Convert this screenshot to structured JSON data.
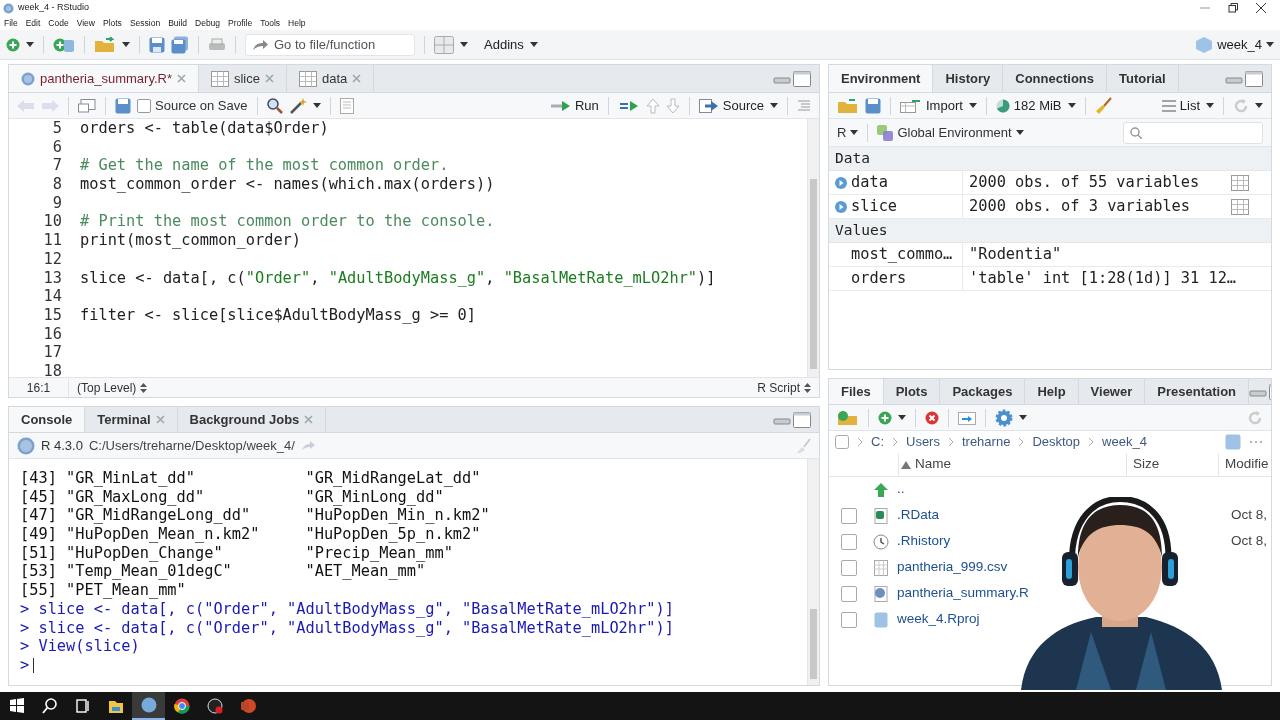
{
  "window": {
    "title": "week_4 - RStudio"
  },
  "menu": [
    "File",
    "Edit",
    "Code",
    "View",
    "Plots",
    "Session",
    "Build",
    "Debug",
    "Profile",
    "Tools",
    "Help"
  ],
  "toolbar": {
    "goto_placeholder": "Go to file/function",
    "addins": "Addins",
    "project": "week_4"
  },
  "editor": {
    "tabs": [
      {
        "label": "pantheria_summary.R*",
        "kind": "script",
        "modified": true,
        "selected": true
      },
      {
        "label": "slice",
        "kind": "data",
        "modified": false,
        "selected": false
      },
      {
        "label": "data",
        "kind": "data",
        "modified": false,
        "selected": false
      }
    ],
    "source_on_save": {
      "label": "Source on Save",
      "checked": false
    },
    "run": "Run",
    "source": "Source",
    "lines": [
      {
        "number": "5",
        "kind": "code",
        "code": "orders <- table(data$Order)"
      },
      {
        "number": "6",
        "kind": "code"
      },
      {
        "number": "7",
        "kind": "comment",
        "code": "# Get the name of the most common order."
      },
      {
        "number": "8",
        "kind": "code",
        "code": "most_common_order <- names(which.max(orders))"
      },
      {
        "number": "9",
        "kind": "code"
      },
      {
        "number": "10",
        "kind": "comment",
        "code": "# Print the most common order to the console."
      },
      {
        "number": "11",
        "kind": "code",
        "code": "print(most_common_order)"
      },
      {
        "number": "12",
        "kind": "code"
      },
      {
        "number": "13",
        "kind": "code",
        "code": "slice <- data[, c(\"Order\", \"AdultBodyMass_g\", \"BasalMetRate_mLO2hr\")]"
      },
      {
        "number": "14",
        "kind": "code"
      },
      {
        "number": "15",
        "kind": "code",
        "code": "filter <- slice[slice$AdultBodyMass_g >= 0]"
      },
      {
        "number": "16",
        "kind": "code"
      },
      {
        "number": "17",
        "kind": "code"
      },
      {
        "number": "18",
        "kind": "code"
      }
    ],
    "status": {
      "position": "16:1",
      "scope": "(Top Level)",
      "file_type": "R Script"
    }
  },
  "console": {
    "tabs": [
      {
        "label": "Console",
        "closable": false,
        "selected": true
      },
      {
        "label": "Terminal",
        "closable": true,
        "selected": false
      },
      {
        "label": "Background Jobs",
        "closable": true,
        "selected": false
      }
    ],
    "version": "R 4.3.0",
    "path": "C:/Users/treharne/Desktop/week_4/",
    "lines": [
      {
        "kind": "output",
        "text": "[43] \"GR_MinLat_dd\"            \"GR_MidRangeLat_dd\""
      },
      {
        "kind": "output",
        "text": "[45] \"GR_MaxLong_dd\"           \"GR_MinLong_dd\""
      },
      {
        "kind": "output",
        "text": "[47] \"GR_MidRangeLong_dd\"      \"HuPopDen_Min_n.km2\""
      },
      {
        "kind": "output",
        "text": "[49] \"HuPopDen_Mean_n.km2\"     \"HuPopDen_5p_n.km2\""
      },
      {
        "kind": "output",
        "text": "[51] \"HuPopDen_Change\"         \"Precip_Mean_mm\""
      },
      {
        "kind": "output",
        "text": "[53] \"Temp_Mean_01degC\"        \"AET_Mean_mm\""
      },
      {
        "kind": "output",
        "text": "[55] \"PET_Mean_mm\""
      },
      {
        "kind": "input",
        "text": "> slice <- data[, c(\"Order\", \"AdultBodyMass_g\", \"BasalMetRate_mLO2hr\")]"
      },
      {
        "kind": "input",
        "text": "> slice <- data[, c(\"Order\", \"AdultBodyMass_g\", \"BasalMetRate_mLO2hr\")]"
      },
      {
        "kind": "input",
        "text": "> View(slice)"
      },
      {
        "kind": "prompt",
        "text": ">"
      }
    ]
  },
  "environment": {
    "tabs": [
      {
        "label": "Environment",
        "selected": true
      },
      {
        "label": "History",
        "selected": false
      },
      {
        "label": "Connections",
        "selected": false
      },
      {
        "label": "Tutorial",
        "selected": false
      }
    ],
    "import": "Import",
    "memory": "182 MiB",
    "view": "List",
    "language": "R",
    "scope": "Global Environment",
    "sections": [
      {
        "title": "Data",
        "items": [
          {
            "kind": "data",
            "name": "data",
            "value": "2000 obs. of 55 variables"
          },
          {
            "kind": "data",
            "name": "slice",
            "value": "2000 obs. of 3 variables"
          }
        ]
      },
      {
        "title": "Values",
        "items": [
          {
            "kind": "value",
            "name": "most_commo…",
            "value": "\"Rodentia\""
          },
          {
            "kind": "value",
            "name": "orders",
            "value": "'table' int [1:28(1d)] 31 12…"
          }
        ]
      }
    ]
  },
  "files": {
    "tabs": [
      {
        "label": "Files",
        "selected": true
      },
      {
        "label": "Plots",
        "selected": false
      },
      {
        "label": "Packages",
        "selected": false
      },
      {
        "label": "Help",
        "selected": false
      },
      {
        "label": "Viewer",
        "selected": false
      },
      {
        "label": "Presentation",
        "selected": false
      }
    ],
    "breadcrumb": [
      "C:",
      "Users",
      "treharne",
      "Desktop",
      "week_4"
    ],
    "columns": [
      "Name",
      "Size",
      "Modifie"
    ],
    "rows": [
      {
        "kind": "up",
        "name": ".."
      },
      {
        "kind": "rdata",
        "name": ".RData",
        "checked": false,
        "modified": "Oct 8,"
      },
      {
        "kind": "history",
        "name": ".Rhistory",
        "checked": false,
        "modified": "Oct 8,"
      },
      {
        "kind": "csv",
        "name": "pantheria_999.csv",
        "checked": false
      },
      {
        "kind": "rscript",
        "name": "pantheria_summary.R",
        "checked": false
      },
      {
        "kind": "rproj",
        "name": "week_4.Rproj",
        "checked": false
      }
    ]
  },
  "taskbar": [
    {
      "kind": "start",
      "active": false
    },
    {
      "kind": "search",
      "active": false
    },
    {
      "kind": "taskview",
      "active": false
    },
    {
      "kind": "folder",
      "active": false
    },
    {
      "kind": "rstudio",
      "active": true
    },
    {
      "kind": "browser",
      "active": false
    },
    {
      "kind": "recorder",
      "active": false
    },
    {
      "kind": "slides",
      "active": false
    }
  ]
}
